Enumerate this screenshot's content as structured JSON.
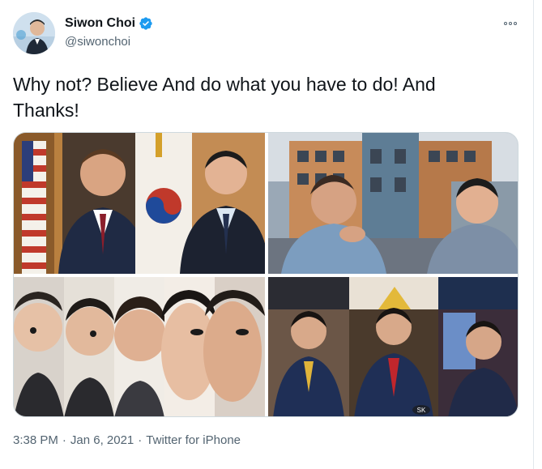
{
  "author": {
    "name": "Siwon Choi",
    "handle": "@siwonchoi",
    "verified": true
  },
  "tweet": {
    "text_line1": "Why not? Believe  And do what you have to do! And",
    "text_line2": "Thanks!"
  },
  "meta": {
    "time": "3:38 PM",
    "separator": "·",
    "date": "Jan 6, 2021",
    "source": "Twitter for iPhone"
  },
  "photo_caption_small": "SK",
  "colors": {
    "verified_blue": "#1d9bf0",
    "text": "#0f1419",
    "secondary": "#536471"
  }
}
